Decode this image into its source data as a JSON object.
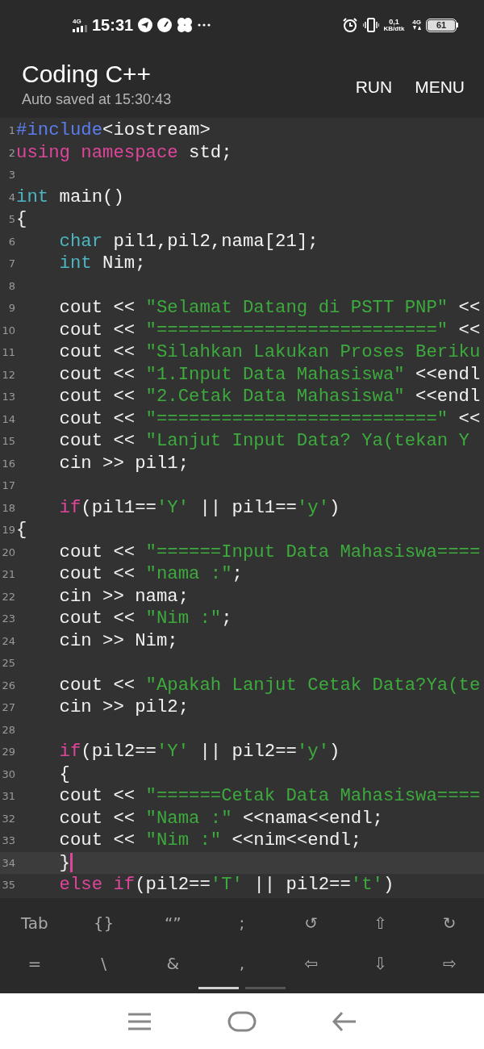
{
  "status_bar": {
    "network": "4G",
    "time": "15:31",
    "speed_value": "0,1",
    "speed_unit": "KB/dtk",
    "network_right": "4G",
    "battery": "61"
  },
  "app_bar": {
    "title": "Coding C++",
    "subtitle": "Auto saved at 15:30:43",
    "actions": [
      "RUN",
      "MENU"
    ]
  },
  "editor": {
    "lines": [
      {
        "number": "1",
        "current": false,
        "indented": false,
        "tokens": [
          {
            "kind": "preprocessor",
            "text": "#include"
          },
          {
            "kind": "plain",
            "text": "<iostream>"
          }
        ]
      },
      {
        "number": "2",
        "current": false,
        "indented": false,
        "tokens": [
          {
            "kind": "keyword",
            "text": "using"
          },
          {
            "kind": "keyword",
            "text": " namespace"
          },
          {
            "kind": "plain",
            "text": " std;"
          }
        ]
      },
      {
        "number": "3",
        "current": false
      },
      {
        "number": "4",
        "current": false,
        "indented": false,
        "tokens": [
          {
            "kind": "type",
            "text": "int"
          },
          {
            "kind": "plain",
            "text": " main()"
          }
        ]
      },
      {
        "number": "5",
        "current": false,
        "indented": false,
        "tokens": [
          {
            "kind": "plain",
            "text": "{"
          }
        ]
      },
      {
        "number": "6",
        "current": false,
        "indented": true,
        "tokens": [
          {
            "kind": "type",
            "text": "char"
          },
          {
            "kind": "plain",
            "text": " pil1,pil2,nama[21];"
          }
        ]
      },
      {
        "number": "7",
        "current": false,
        "indented": true,
        "tokens": [
          {
            "kind": "type",
            "text": "int"
          },
          {
            "kind": "plain",
            "text": " Nim;"
          }
        ]
      },
      {
        "number": "8",
        "current": false
      },
      {
        "number": "9",
        "current": false,
        "indented": true,
        "tokens": [
          {
            "kind": "plain",
            "text": "cout << "
          },
          {
            "kind": "string",
            "text": "\"Selamat Datang di PSTT PNP\""
          },
          {
            "kind": "plain",
            "text": " <<"
          }
        ]
      },
      {
        "number": "10",
        "current": false,
        "indented": true,
        "tokens": [
          {
            "kind": "plain",
            "text": "cout << "
          },
          {
            "kind": "string",
            "text": "\"==========================\""
          },
          {
            "kind": "plain",
            "text": " <<"
          }
        ]
      },
      {
        "number": "11",
        "current": false,
        "indented": true,
        "tokens": [
          {
            "kind": "plain",
            "text": "cout << "
          },
          {
            "kind": "string",
            "text": "\"Silahkan Lakukan Proses Beriku"
          }
        ]
      },
      {
        "number": "12",
        "current": false,
        "indented": true,
        "tokens": [
          {
            "kind": "plain",
            "text": "cout << "
          },
          {
            "kind": "string",
            "text": "\"1.Input Data Mahasiswa\""
          },
          {
            "kind": "plain",
            "text": " <<endl"
          }
        ]
      },
      {
        "number": "13",
        "current": false,
        "indented": true,
        "tokens": [
          {
            "kind": "plain",
            "text": "cout << "
          },
          {
            "kind": "string",
            "text": "\"2.Cetak Data Mahasiswa\""
          },
          {
            "kind": "plain",
            "text": " <<endl"
          }
        ]
      },
      {
        "number": "14",
        "current": false,
        "indented": true,
        "tokens": [
          {
            "kind": "plain",
            "text": "cout << "
          },
          {
            "kind": "string",
            "text": "\"==========================\""
          },
          {
            "kind": "plain",
            "text": " <<"
          }
        ]
      },
      {
        "number": "15",
        "current": false,
        "indented": true,
        "tokens": [
          {
            "kind": "plain",
            "text": "cout << "
          },
          {
            "kind": "string",
            "text": "\"Lanjut Input Data? Ya(tekan Y"
          }
        ]
      },
      {
        "number": "16",
        "current": false,
        "indented": true,
        "tokens": [
          {
            "kind": "plain",
            "text": "cin >> pil1;"
          }
        ]
      },
      {
        "number": "17",
        "current": false
      },
      {
        "number": "18",
        "current": false,
        "indented": true,
        "tokens": [
          {
            "kind": "keyword",
            "text": "if"
          },
          {
            "kind": "plain",
            "text": "(pil1=="
          },
          {
            "kind": "string",
            "text": "'Y'"
          },
          {
            "kind": "plain",
            "text": " || pil1=="
          },
          {
            "kind": "string",
            "text": "'y'"
          },
          {
            "kind": "plain",
            "text": ")"
          }
        ]
      },
      {
        "number": "19",
        "current": false,
        "indented": false,
        "tokens": [
          {
            "kind": "plain",
            "text": "{"
          }
        ]
      },
      {
        "number": "20",
        "current": false,
        "indented": true,
        "tokens": [
          {
            "kind": "plain",
            "text": "cout << "
          },
          {
            "kind": "string",
            "text": "\"======Input Data Mahasiswa===="
          }
        ]
      },
      {
        "number": "21",
        "current": false,
        "indented": true,
        "tokens": [
          {
            "kind": "plain",
            "text": "cout << "
          },
          {
            "kind": "string",
            "text": "\"nama :\""
          },
          {
            "kind": "plain",
            "text": ";"
          }
        ]
      },
      {
        "number": "22",
        "current": false,
        "indented": true,
        "tokens": [
          {
            "kind": "plain",
            "text": "cin >> nama;"
          }
        ]
      },
      {
        "number": "23",
        "current": false,
        "indented": true,
        "tokens": [
          {
            "kind": "plain",
            "text": "cout << "
          },
          {
            "kind": "string",
            "text": "\"Nim :\""
          },
          {
            "kind": "plain",
            "text": ";"
          }
        ]
      },
      {
        "number": "24",
        "current": false,
        "indented": true,
        "tokens": [
          {
            "kind": "plain",
            "text": "cin >> Nim;"
          }
        ]
      },
      {
        "number": "25",
        "current": false
      },
      {
        "number": "26",
        "current": false,
        "indented": true,
        "tokens": [
          {
            "kind": "plain",
            "text": "cout << "
          },
          {
            "kind": "string",
            "text": "\"Apakah Lanjut Cetak Data?Ya(te"
          }
        ]
      },
      {
        "number": "27",
        "current": false,
        "indented": true,
        "tokens": [
          {
            "kind": "plain",
            "text": "cin >> pil2;"
          }
        ]
      },
      {
        "number": "28",
        "current": false
      },
      {
        "number": "29",
        "current": false,
        "indented": true,
        "tokens": [
          {
            "kind": "keyword",
            "text": "if"
          },
          {
            "kind": "plain",
            "text": "(pil2=="
          },
          {
            "kind": "string",
            "text": "'Y'"
          },
          {
            "kind": "plain",
            "text": " || pil2=="
          },
          {
            "kind": "string",
            "text": "'y'"
          },
          {
            "kind": "plain",
            "text": ")"
          }
        ]
      },
      {
        "number": "30",
        "current": false,
        "indented": true,
        "tokens": [
          {
            "kind": "plain",
            "text": "{"
          }
        ]
      },
      {
        "number": "31",
        "current": false,
        "indented": true,
        "tokens": [
          {
            "kind": "plain",
            "text": "cout << "
          },
          {
            "kind": "string",
            "text": "\"======Cetak Data Mahasiswa===="
          }
        ]
      },
      {
        "number": "32",
        "current": false,
        "indented": true,
        "tokens": [
          {
            "kind": "plain",
            "text": "cout << "
          },
          {
            "kind": "string",
            "text": "\"Nama :\""
          },
          {
            "kind": "plain",
            "text": " <<nama<<endl;"
          }
        ]
      },
      {
        "number": "33",
        "current": false,
        "indented": true,
        "tokens": [
          {
            "kind": "plain",
            "text": "cout << "
          },
          {
            "kind": "string",
            "text": "\"Nim :\""
          },
          {
            "kind": "plain",
            "text": " <<nim<<endl;"
          }
        ]
      },
      {
        "number": "34",
        "current": true,
        "indented": true,
        "tokens": [
          {
            "kind": "plain",
            "text": "}"
          }
        ]
      },
      {
        "number": "35",
        "current": false,
        "indented": true,
        "tokens": [
          {
            "kind": "keyword",
            "text": "else"
          },
          {
            "kind": "keyword",
            "text": " if"
          },
          {
            "kind": "plain",
            "text": "(pil2=="
          },
          {
            "kind": "string",
            "text": "'T'"
          },
          {
            "kind": "plain",
            "text": " || pil2=="
          },
          {
            "kind": "string",
            "text": "'t'"
          },
          {
            "kind": "plain",
            "text": ")"
          }
        ]
      }
    ]
  },
  "extra_keys": {
    "rows": [
      [
        "Tab",
        "{}",
        "“”",
        ";",
        "↺",
        "⇧",
        "↻"
      ],
      [
        "=",
        "\\",
        "&",
        ",",
        "⇦",
        "⇩",
        "⇨"
      ]
    ],
    "pages": [
      {
        "selected": true
      },
      {
        "selected": false
      }
    ]
  }
}
